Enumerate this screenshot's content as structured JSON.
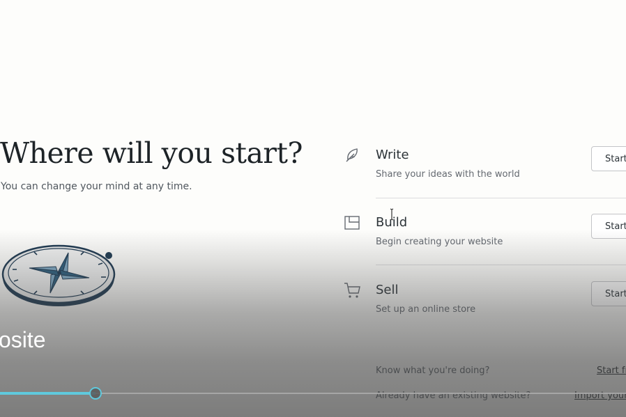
{
  "page": {
    "heading": "Where will you start?",
    "subheading": "You can change your mind at any time."
  },
  "options": [
    {
      "title": "Write",
      "description": "Share your ideas with the world",
      "button_label": "Start",
      "icon": "feather-icon"
    },
    {
      "title": "Build",
      "description": "Begin creating your website",
      "button_label": "Start",
      "icon": "layout-icon"
    },
    {
      "title": "Sell",
      "description": "Set up an online store",
      "button_label": "Start",
      "icon": "cart-icon"
    }
  ],
  "footer": {
    "know_question": "Know what you're doing?",
    "know_link": "Start from scratch",
    "existing_question": "Already have an existing website?",
    "existing_link": "Import your site content"
  },
  "video": {
    "caption": "osite",
    "progress_fraction": 0.153,
    "accent_color": "#5fc9dd"
  },
  "illustration": {
    "icon": "compass-icon"
  }
}
